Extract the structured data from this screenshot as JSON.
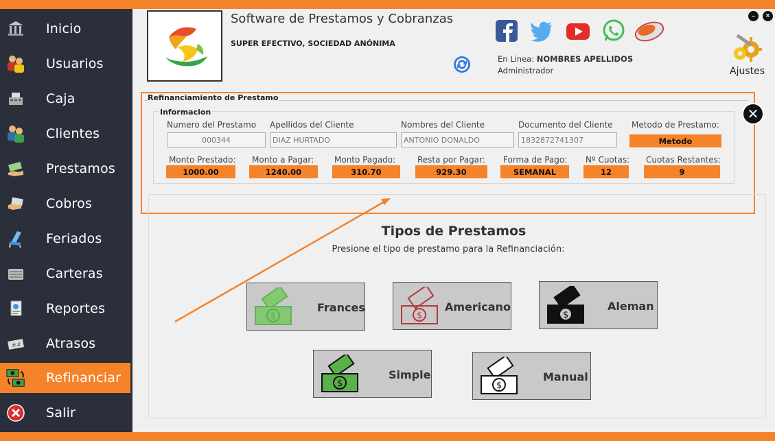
{
  "app": {
    "title": "Software de Prestamos y Cobranzas",
    "company": "SUPER EFECTIVO, SOCIEDAD ANÓNIMA",
    "online_prefix": "En Linea:",
    "online_user": "NOMBRES APELLIDOS",
    "role": "Administrador",
    "settings_label": "Ajustes",
    "accent": "#f5832a",
    "sidebar_bg": "#2b2f3c"
  },
  "sidebar": {
    "items": [
      {
        "label": "Inicio",
        "icon": "bank-icon"
      },
      {
        "label": "Usuarios",
        "icon": "users-icon"
      },
      {
        "label": "Caja",
        "icon": "cash-register-icon"
      },
      {
        "label": "Clientes",
        "icon": "clients-icon"
      },
      {
        "label": "Prestamos",
        "icon": "loan-icon"
      },
      {
        "label": "Cobros",
        "icon": "payment-icon"
      },
      {
        "label": "Feriados",
        "icon": "beach-chair-icon"
      },
      {
        "label": "Carteras",
        "icon": "wallet-icon"
      },
      {
        "label": "Reportes",
        "icon": "report-icon"
      },
      {
        "label": "Atrasos",
        "icon": "calendar-late-icon"
      },
      {
        "label": "Refinanciar",
        "icon": "money-refinance-icon"
      },
      {
        "label": "Salir",
        "icon": "exit-icon"
      }
    ],
    "active": "Refinanciar"
  },
  "social": [
    "facebook-icon",
    "twitter-icon",
    "youtube-icon",
    "whatsapp-icon",
    "mouse-icon"
  ],
  "refinance": {
    "group_title": "Refinanciamiento de Prestamo",
    "info_title": "Informacion",
    "labels": {
      "loan_number": "Numero del Prestamo",
      "surnames": "Apellidos del Cliente",
      "names": "Nombres del Cliente",
      "document": "Documento del Cliente",
      "method": "Metodo de Prestamo:",
      "lent": "Monto Prestado:",
      "to_pay": "Monto a Pagar:",
      "paid": "Monto Pagado:",
      "remaining": "Resta por Pagar:",
      "payment_form": "Forma de Pago:",
      "installments": "Nº Cuotas:",
      "remaining_installments": "Cuotas Restantes:"
    },
    "values": {
      "loan_number": "000344",
      "surnames": "DIAZ HURTADO",
      "names": "ANTONIO DONALDO",
      "document": "1832872741307",
      "method": "Metodo",
      "lent": "1000.00",
      "to_pay": "1240.00",
      "paid": "310.70",
      "remaining": "929.30",
      "payment_form": "SEMANAL",
      "installments": "12",
      "remaining_installments": "9"
    }
  },
  "types": {
    "title": "Tipos de Prestamos",
    "subtitle": "Presione el tipo de prestamo para la Refinanciación:",
    "buttons": [
      {
        "label": "Frances",
        "color": "#5ab04a"
      },
      {
        "label": "Americano",
        "color": "#b23a3a"
      },
      {
        "label": "Aleman",
        "color": "#111111"
      },
      {
        "label": "Simple",
        "color": "#5ab04a"
      },
      {
        "label": "Manual",
        "color": "#111111"
      }
    ]
  }
}
